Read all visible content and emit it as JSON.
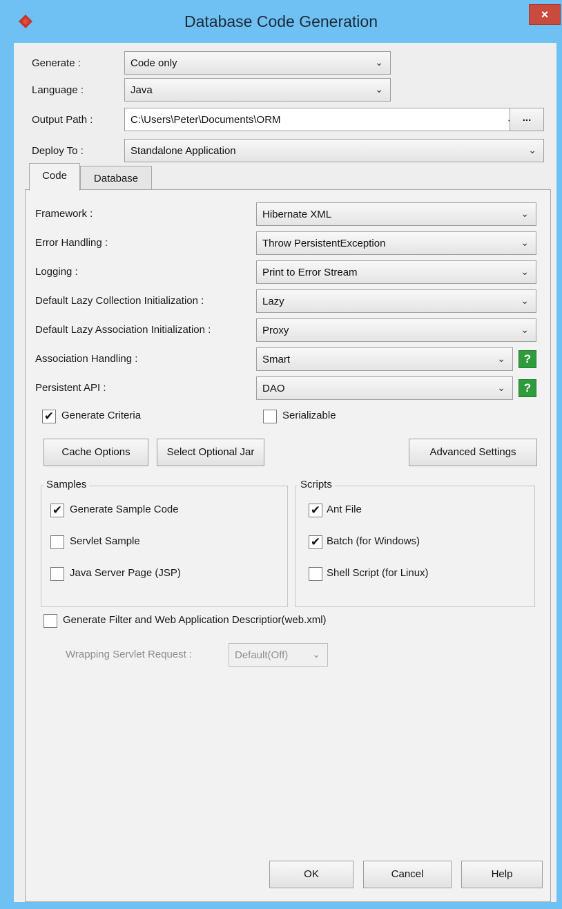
{
  "window": {
    "title": "Database Code Generation",
    "close_label": "×",
    "accent_color": "#6ec1f2"
  },
  "top": {
    "generate": {
      "label": "Generate :",
      "value": "Code only"
    },
    "language": {
      "label": "Language :",
      "value": "Java"
    },
    "output_path": {
      "label": "Output Path :",
      "value": "C:\\Users\\Peter\\Documents\\ORM",
      "browse_label": "..."
    },
    "deploy_to": {
      "label": "Deploy To :",
      "value": "Standalone Application"
    }
  },
  "tabs": [
    {
      "label": "Code",
      "active": true
    },
    {
      "label": "Database",
      "active": false
    }
  ],
  "code": {
    "framework": {
      "label": "Framework :",
      "value": "Hibernate XML"
    },
    "error_handling": {
      "label": "Error Handling :",
      "value": "Throw PersistentException"
    },
    "logging": {
      "label": "Logging :",
      "value": "Print to Error Stream"
    },
    "lazy_collection": {
      "label": "Default Lazy Collection Initialization :",
      "value": "Lazy"
    },
    "lazy_association": {
      "label": "Default Lazy Association Initialization :",
      "value": "Proxy"
    },
    "association_handling": {
      "label": "Association Handling :",
      "value": "Smart",
      "help": "?"
    },
    "persistent_api": {
      "label": "Persistent API :",
      "value": "DAO",
      "help": "?"
    },
    "generate_criteria": {
      "label": "Generate Criteria",
      "checked": true
    },
    "serializable": {
      "label": "Serializable",
      "checked": false
    },
    "buttons": {
      "cache_options": "Cache Options",
      "select_optional_jar": "Select Optional Jar",
      "advanced_settings": "Advanced Settings"
    },
    "samples": {
      "title": "Samples",
      "items": [
        {
          "label": "Generate Sample Code",
          "checked": true
        },
        {
          "label": "Servlet Sample",
          "checked": false
        },
        {
          "label": "Java Server Page (JSP)",
          "checked": false
        }
      ]
    },
    "scripts": {
      "title": "Scripts",
      "items": [
        {
          "label": "Ant File",
          "checked": true
        },
        {
          "label": "Batch (for Windows)",
          "checked": true
        },
        {
          "label": "Shell Script (for Linux)",
          "checked": false
        }
      ]
    },
    "filter": {
      "label": "Generate Filter and Web Application Descriptior(web.xml)",
      "checked": false
    },
    "wrapping": {
      "label": "Wrapping Servlet Request :",
      "value": "Default(Off)"
    }
  },
  "footer": {
    "ok": "OK",
    "cancel": "Cancel",
    "help": "Help"
  }
}
